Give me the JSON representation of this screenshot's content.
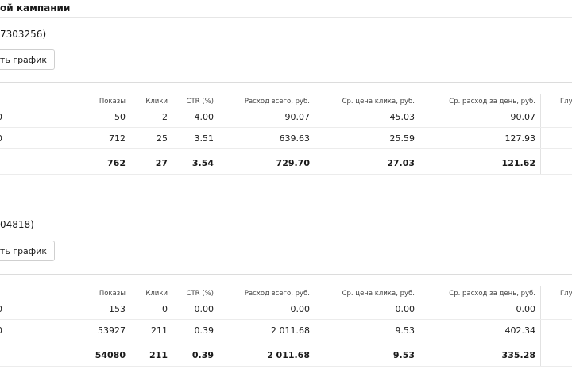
{
  "page": {
    "title": "ой кампании"
  },
  "campaigns": [
    {
      "id_label": "7303256)",
      "chart_button": "ть график",
      "headers": [
        "Показы",
        "Клики",
        "CTR (%)",
        "Расход всего, руб.",
        "Ср. цена клика, руб.",
        "Ср. расход за день, руб.",
        "Глу"
      ],
      "rows": [
        {
          "mark": "0",
          "cells": [
            "50",
            "2",
            "4.00",
            "90.07",
            "45.03",
            "90.07"
          ]
        },
        {
          "mark": "0",
          "cells": [
            "712",
            "25",
            "3.51",
            "639.63",
            "25.59",
            "127.93"
          ]
        }
      ],
      "total": [
        "762",
        "27",
        "3.54",
        "729.70",
        "27.03",
        "121.62"
      ]
    },
    {
      "id_label": "04818)",
      "chart_button": "ть график",
      "headers": [
        "Показы",
        "Клики",
        "CTR (%)",
        "Расход всего, руб.",
        "Ср. цена клика, руб.",
        "Ср. расход за день, руб.",
        "Глу"
      ],
      "rows": [
        {
          "mark": "0",
          "cells": [
            "153",
            "0",
            "0.00",
            "0.00",
            "0.00",
            "0.00"
          ]
        },
        {
          "mark": "0",
          "cells": [
            "53927",
            "211",
            "0.39",
            "2 011.68",
            "9.53",
            "402.34"
          ]
        }
      ],
      "total": [
        "54080",
        "211",
        "0.39",
        "2 011.68",
        "9.53",
        "335.28"
      ]
    }
  ]
}
